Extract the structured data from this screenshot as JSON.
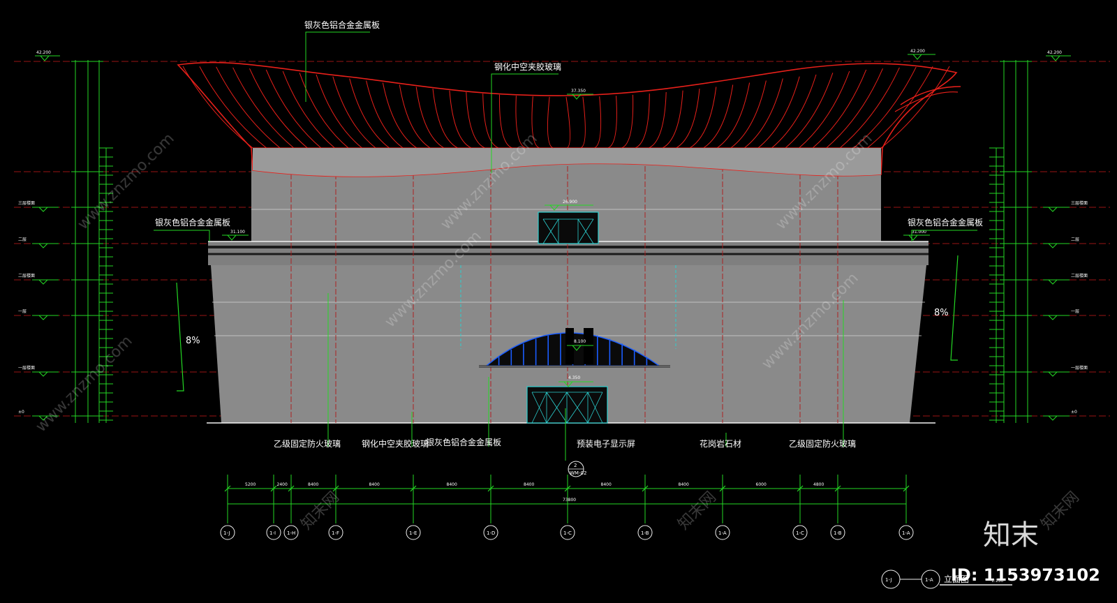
{
  "labels": {
    "roof_top": "银灰色铝合金金属板",
    "glass_top": "钢化中空夹胶玻璃",
    "left_panel": "银灰色铝合金金属板",
    "right_panel": "银灰色铝合金金属板",
    "bottom": [
      "乙级固定防火玻璃",
      "钢化中空夹胶玻璃",
      "银灰色铝合金金属板",
      "预装电子显示屏",
      "花岗岩石材",
      "乙级固定防火玻璃"
    ]
  },
  "slope_left": "8%",
  "slope_right": "8%",
  "elevations": {
    "roof_left": "42.200",
    "roof_right": "42.200",
    "roof_mid": "37.350",
    "window_top": "26.900",
    "parapet_left": "31.100",
    "parapet_right": "31.000",
    "arch": "8.100",
    "door": "4.350"
  },
  "left_levels": [
    "三层楼面",
    "二层",
    "二层楼面",
    "一层",
    "一层楼面",
    "±0"
  ],
  "right_levels": [
    "三层楼面",
    "二层",
    "二层楼面",
    "一层",
    "一层楼面",
    "±0"
  ],
  "axes": [
    "1-J",
    "1-I",
    "1-H",
    "1-F",
    "1-E",
    "1-D",
    "1-C",
    "1-B",
    "1-A",
    "1-C",
    "1-B",
    "1-A"
  ],
  "dims": [
    "5200",
    "2400",
    "8400",
    "8400",
    "8400",
    "8400",
    "8400",
    "8400",
    "6000",
    "4800"
  ],
  "total_dim": "73800",
  "section_mark": "2",
  "section_sub": "WM-02",
  "title_block": {
    "axis_from": "1-J",
    "axis_to": "1-A",
    "name": "立面图",
    "scale": "1:150"
  },
  "watermark": {
    "logo": "知末",
    "id": "ID: 1153973102",
    "site": "www.znzmo.com",
    "cn": "知末网"
  },
  "colors": {
    "background": "#000000",
    "roof": "#e8201a",
    "facade": "#8a8a8a",
    "leader": "#24d824",
    "grid": "#b01818",
    "glass": "#1a5cff",
    "door": "#2bd0d0"
  }
}
